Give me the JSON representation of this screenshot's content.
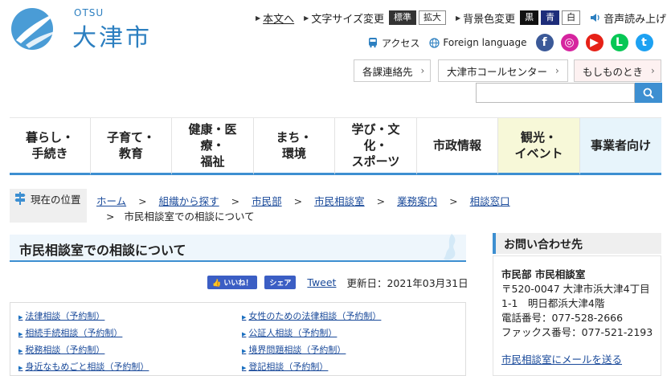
{
  "header": {
    "logo_roman": "OTSU",
    "logo_name": "大津市",
    "skip_link": "本文へ",
    "font_size_label": "文字サイズ変更",
    "font_size_standard": "標準",
    "font_size_large": "拡大",
    "bg_color_label": "背景色変更",
    "bg_black": "黒",
    "bg_blue": "青",
    "bg_white": "白",
    "speech_label": "音声読み上げ",
    "access_label": "アクセス",
    "foreign_label": "Foreign language",
    "sns": [
      {
        "name": "facebook-icon",
        "color": "#3b5998",
        "glyph": "f"
      },
      {
        "name": "instagram-icon",
        "color": "#d6249f",
        "glyph": "◎"
      },
      {
        "name": "youtube-icon",
        "color": "#e62117",
        "glyph": "▶"
      },
      {
        "name": "line-icon",
        "color": "#06c755",
        "glyph": "L"
      },
      {
        "name": "twitter-icon",
        "color": "#1da1f2",
        "glyph": "t"
      }
    ],
    "quick_buttons": [
      "各課連絡先",
      "大津市コールセンター",
      "もしものとき"
    ]
  },
  "nav": [
    {
      "label": "暮らし・\n手続き",
      "bg": "#ffffff"
    },
    {
      "label": "子育て・\n教育",
      "bg": "#ffffff"
    },
    {
      "label": "健康・医\n療・\n福祉",
      "bg": "#ffffff"
    },
    {
      "label": "まち・\n環境",
      "bg": "#ffffff"
    },
    {
      "label": "学び・文\n化・\nスポーツ",
      "bg": "#ffffff"
    },
    {
      "label": "市政情報",
      "bg": "#ffffff"
    },
    {
      "label": "観光・\nイベント",
      "bg": "#f7f8d8"
    },
    {
      "label": "事業者向け",
      "bg": "#e7f4fb"
    }
  ],
  "breadcrumb": {
    "label": "現在の位置",
    "items": [
      "ホーム",
      "組織から探す",
      "市民部",
      "市民相談室",
      "業務案内",
      "相談窓口"
    ],
    "current": "市民相談室での相談について"
  },
  "main": {
    "title": "市民相談室での相談について",
    "like_label": "いいね！",
    "share_label": "シェア",
    "tweet_label": "Tweet",
    "updated": "更新日：2021年03月31日",
    "links": [
      "法律相談（予約制）",
      "女性のための法律相談（予約制）",
      "相続手続相談（予約制）",
      "公証人相談（予約制）",
      "税務相談（予約制）",
      "境界問題相談（予約制）",
      "身近なもめごと相談（予約制）",
      "登記相談（予約制）"
    ]
  },
  "contact": {
    "title": "お問い合わせ先",
    "dept": "市民部 市民相談室",
    "address1": "〒520-0047 大津市浜大津4丁目",
    "address2": "1-1　明日都浜大津4階",
    "phone": "電話番号：077-528-2666",
    "fax": "ファックス番号：077-521-2193",
    "mail_link": "市民相談室にメールを送る"
  },
  "colors": {
    "accent": "#3d8fd1",
    "logo": "#2c7fc0",
    "link": "#1a4a9a"
  }
}
